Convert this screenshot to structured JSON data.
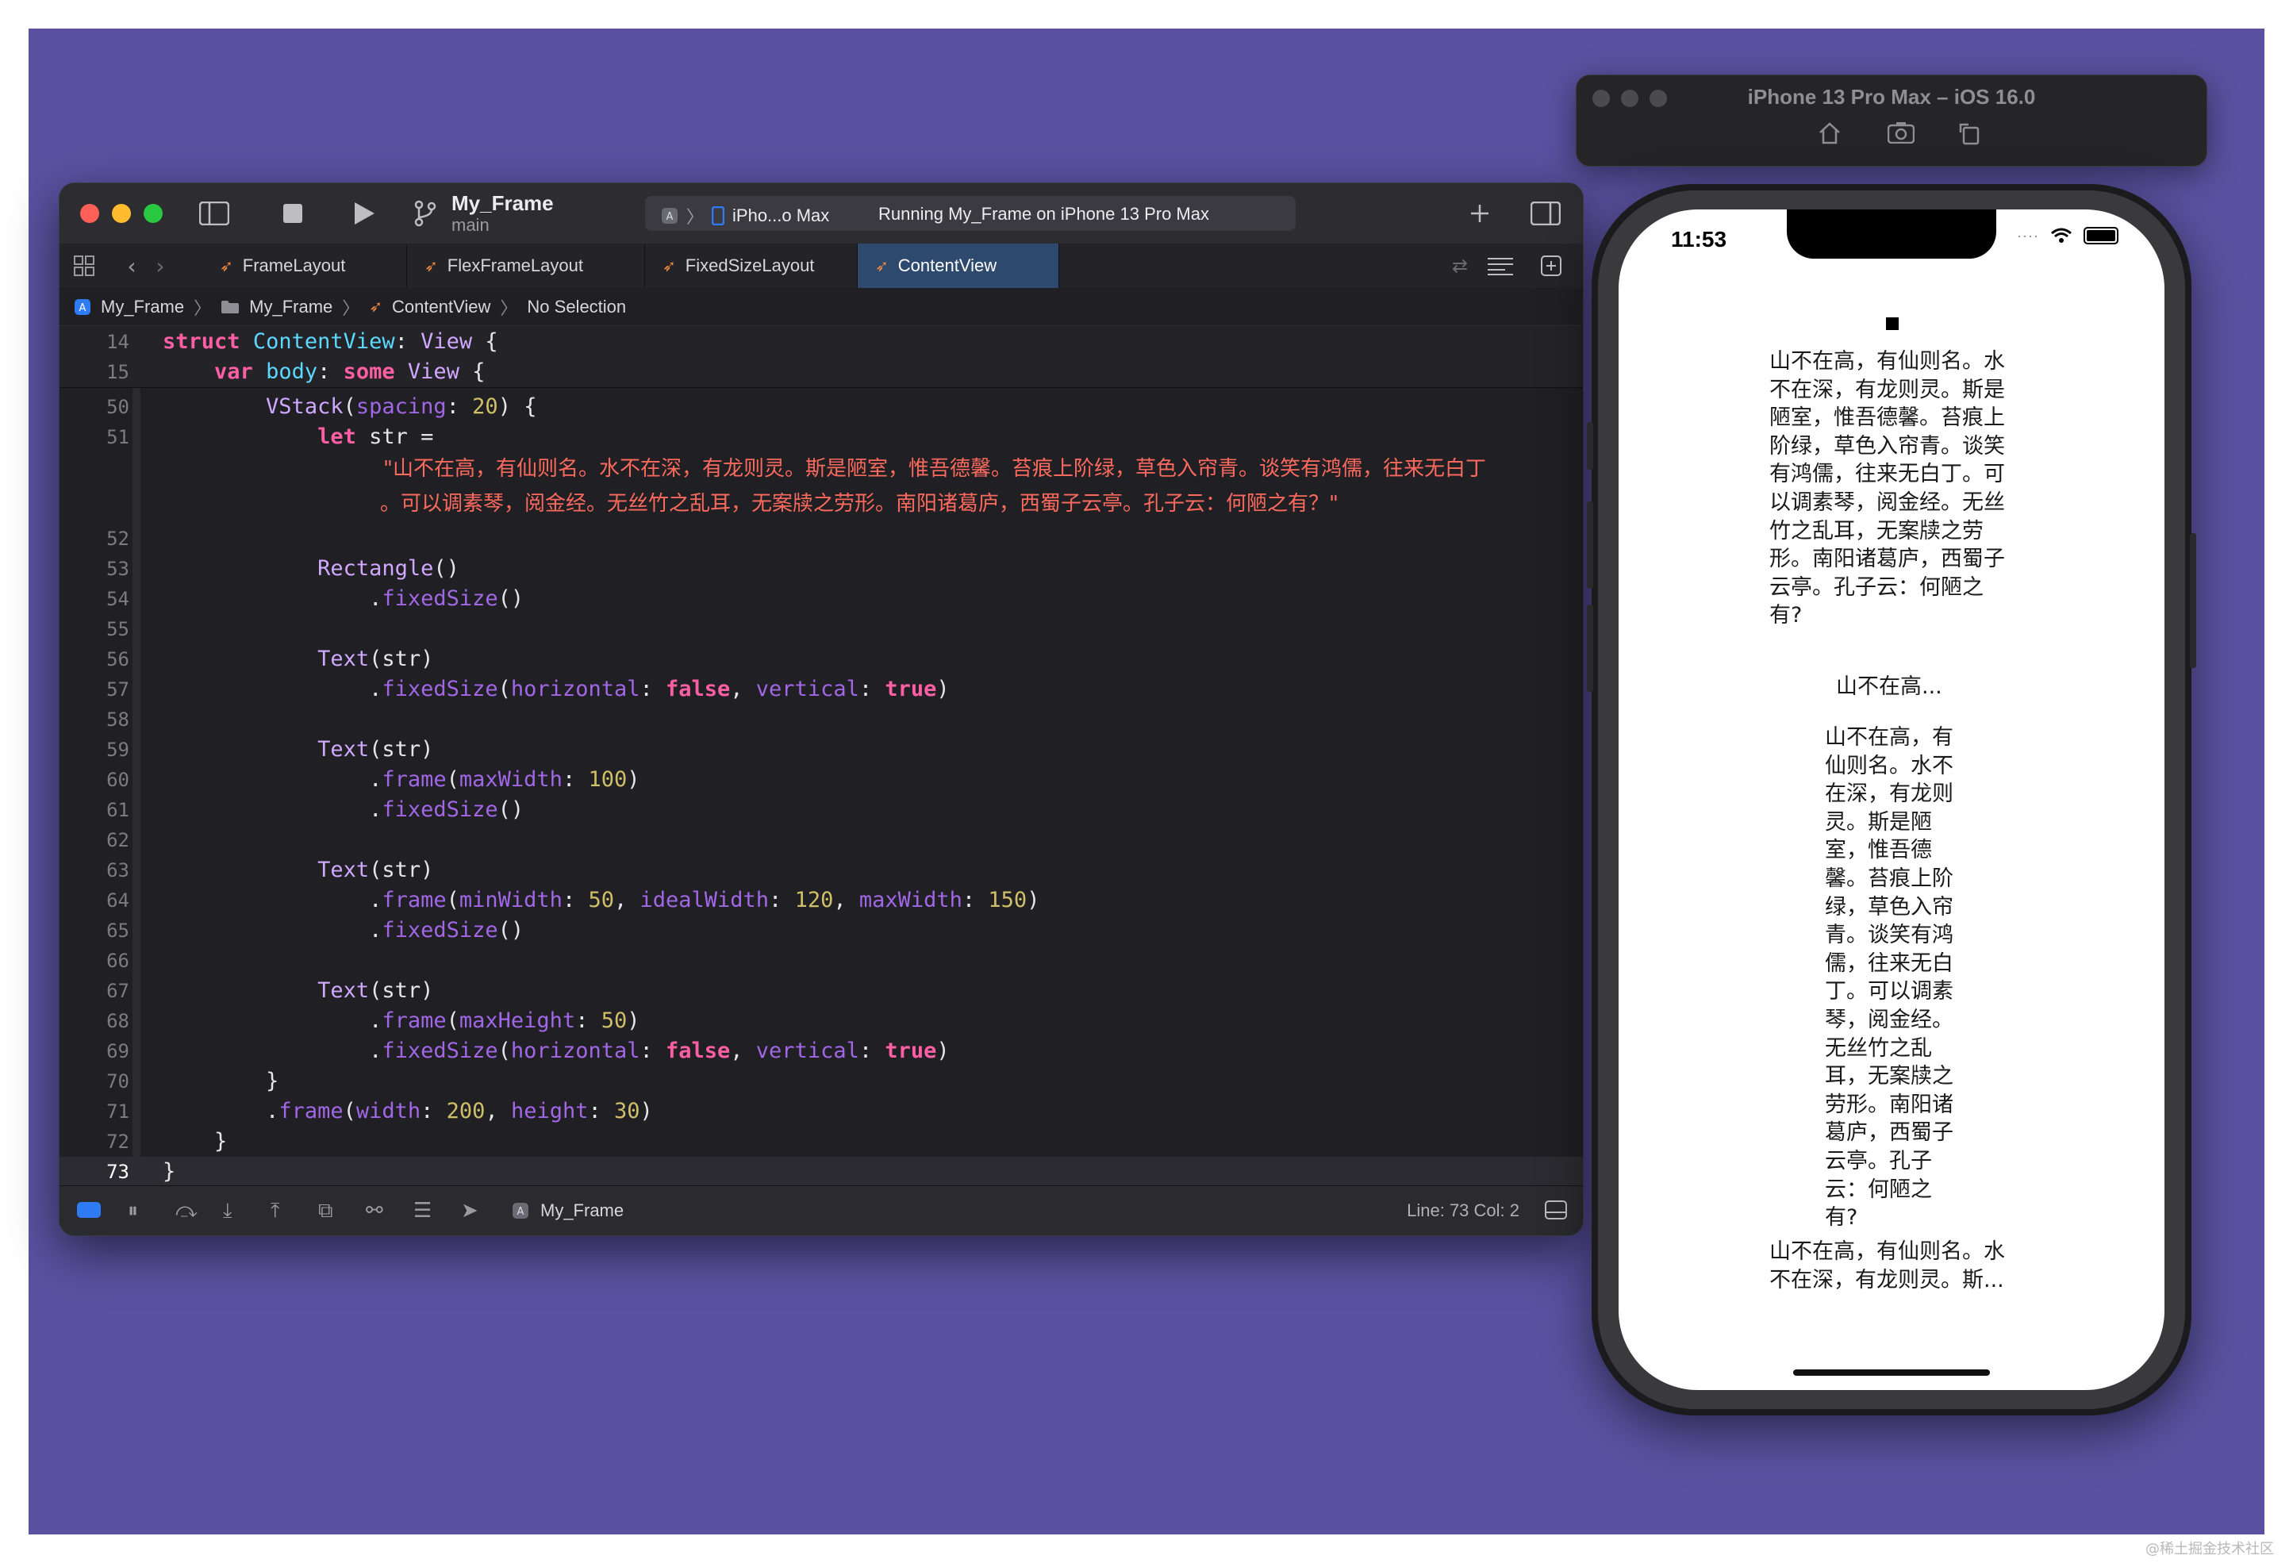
{
  "xcode": {
    "project_name": "My_Frame",
    "branch": "main",
    "destination": "iPho...o Max",
    "status": "Running My_Frame on iPhone 13 Pro Max",
    "tabs": [
      {
        "label": "FrameLayout"
      },
      {
        "label": "FlexFrameLayout"
      },
      {
        "label": "FixedSizeLayout"
      },
      {
        "label": "ContentView"
      }
    ],
    "breadcrumb": [
      "My_Frame",
      "My_Frame",
      "ContentView",
      "No Selection"
    ],
    "status_scheme": "My_Frame",
    "cursor": "Line: 73  Col: 2",
    "string_line_1": "\"山不在高，有仙则名。水不在深，有龙则灵。斯是陋室，惟吾德馨。苔痕上阶绿，草色入帘青。谈笑有鸿儒，往来无白丁",
    "string_line_2": "。可以调素琴，阅金经。无丝竹之乱耳，无案牍之劳形。南阳诸葛庐，西蜀子云亭。孔子云：何陋之有？\""
  },
  "simulator": {
    "title": "iPhone 13 Pro Max – iOS 16.0",
    "time": "11:53",
    "text1": "山不在高，有仙则名。水不在深，有龙则灵。斯是陋室，惟吾德馨。苔痕上阶绿，草色入帘青。谈笑有鸿儒，往来无白丁。可以调素琴，阅金经。无丝竹之乱耳，无案牍之劳形。南阳诸葛庐，西蜀子云亭。孔子云：何陋之有?",
    "text2": "山不在高...",
    "text3": "山不在高，有仙则名。水不在深，有龙则灵。斯是陋室，惟吾德馨。苔痕上阶绿，草色入帘青。谈笑有鸿儒，往来无白丁。可以调素琴，阅金经。无丝竹之乱耳，无案牍之劳形。南阳诸葛庐，西蜀子云亭。孔子云：何陋之有?",
    "text4": "山不在高，有仙则名。水不在深，有龙则灵。斯..."
  },
  "watermark": "@稀土掘金技术社区"
}
